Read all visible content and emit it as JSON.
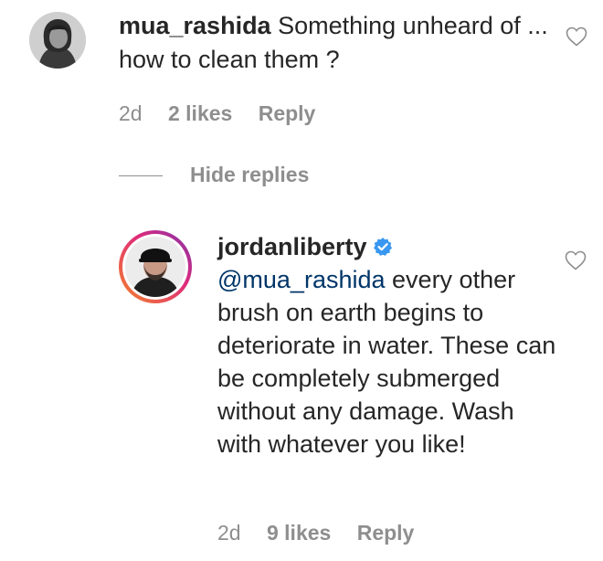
{
  "comment": {
    "username": "mua_rashida",
    "text": "Something unheard of ... how to clean them ?",
    "time": "2d",
    "likes": "2 likes",
    "reply_label": "Reply"
  },
  "hide_replies_label": "Hide replies",
  "reply": {
    "username": "jordanliberty",
    "mention": "@mua_rashida",
    "text": "every other brush on earth begins to deteriorate in water. These can be completely submerged without any damage. Wash with whatever you like!",
    "time": "2d",
    "likes": "9 likes",
    "reply_label": "Reply"
  },
  "icons": {
    "like": "heart-outline-icon",
    "verified": "verified-badge-icon"
  },
  "colors": {
    "primary_text": "#262626",
    "secondary_text": "#8e8e8e",
    "mention": "#003569",
    "verified": "#3897f0"
  }
}
